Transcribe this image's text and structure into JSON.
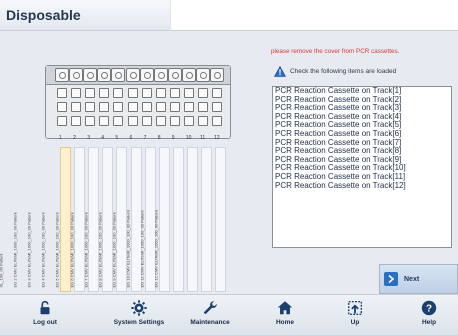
{
  "header": {
    "title": "Disposable"
  },
  "warning": "please remove the cover from PCR cassettes.",
  "check_text": "Check the following items are loaded",
  "items": [
    "PCR Reaction Cassette on Track[1]",
    "PCR Reaction Cassette on Track[2]",
    "PCR Reaction Cassette on Track[3]",
    "PCR Reaction Cassette on Track[4]",
    "PCR Reaction Cassette on Track[5]",
    "PCR Reaction Cassette on Track[6]",
    "PCR Reaction Cassette on Track[7]",
    "PCR Reaction Cassette on Track[8]",
    "PCR Reaction Cassette on Track[9]",
    "PCR Reaction Cassette on Track[10]",
    "PCR Reaction Cassette on Track[11]",
    "PCR Reaction Cassette on Track[12]"
  ],
  "track_numbers": [
    "1",
    "2",
    "3",
    "4",
    "5",
    "6",
    "7",
    "8",
    "9",
    "10",
    "11",
    "12"
  ],
  "track_labels": [
    "XL_100_00 Patient",
    "EG 2 CMV ELITeMt_1000_100_00 Patient",
    "EG 3 CMV ELITeMt_1000_100_00 Patient",
    "EG 4 CMV ELITeMt_1000_100_00 Patient",
    "EG 5 CMV ELITeMt_1000_100_00 Patient",
    "EG 6 CMV ELITeMt_1000_100_00 Patient",
    "EG 7 CMV ELITeMt_1000_100_00 Patient",
    "EG 8 CMV ELITeMt_1000_100_00 Patient",
    "EG 9 CMV ELITeMt_1000_100_00 Patient",
    "EG 10 CMV ELITeMt_1000_100_00 Patient",
    "EG 11 CMV ELITeMt_1000_100_00 Patient",
    "EG 12 CMV ELITeMt_1000_100_00 Patient"
  ],
  "next_label": "Next",
  "nav": [
    {
      "label": "Log out",
      "icon": "lock-icon"
    },
    {
      "label": "System Settings",
      "icon": "gear-icon"
    },
    {
      "label": "Maintenance",
      "icon": "wrench-icon"
    },
    {
      "label": "Home",
      "icon": "home-icon"
    },
    {
      "label": "Up",
      "icon": "up-icon"
    },
    {
      "label": "Help",
      "icon": "help-icon"
    }
  ],
  "colors": {
    "accent": "#2b6fc4",
    "warning": "#d83a3a",
    "selected_track": "#fdf0cc"
  }
}
